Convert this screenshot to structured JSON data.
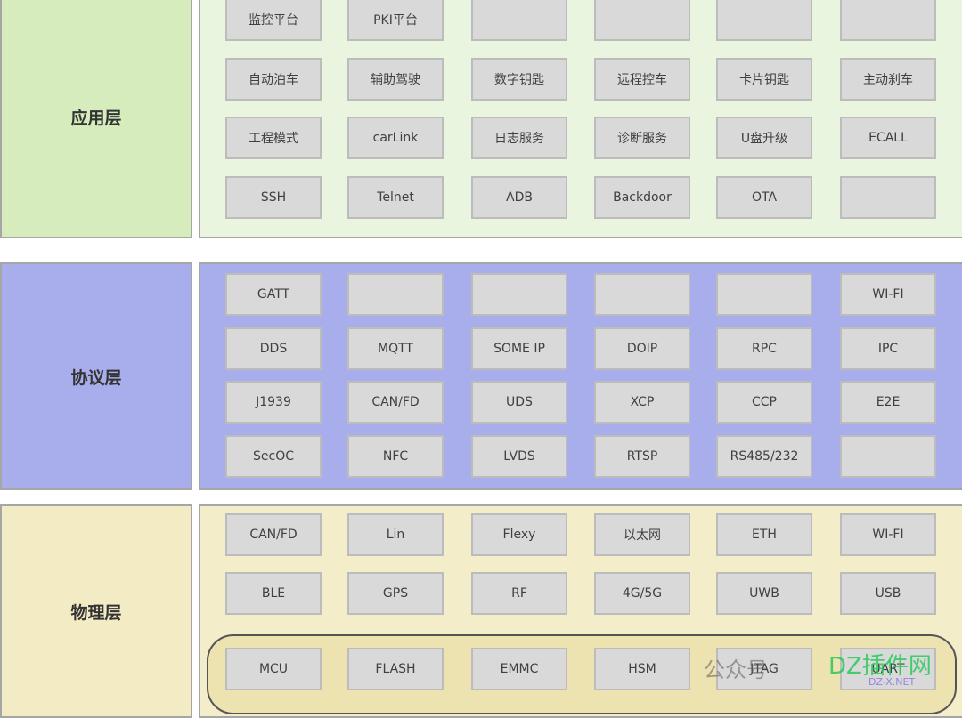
{
  "layers": [
    {
      "name": "应用层",
      "colors": {
        "label_bg": "#d6ecbd",
        "panel_bg": "#eaf5df"
      },
      "rows": [
        [
          "监控平台",
          "PKI平台",
          "",
          "",
          "",
          ""
        ],
        [
          "自动泊车",
          "辅助驾驶",
          "数字钥匙",
          "远程控车",
          "卡片钥匙",
          "主动刹车"
        ],
        [
          "工程模式",
          "carLink",
          "日志服务",
          "诊断服务",
          "U盘升级",
          "ECALL"
        ],
        [
          "SSH",
          "Telnet",
          "ADB",
          "Backdoor",
          "OTA",
          ""
        ]
      ]
    },
    {
      "name": "协议层",
      "colors": {
        "label_bg": "#a7aeeb",
        "panel_bg": "#a7aeeb"
      },
      "rows": [
        [
          "GATT",
          "",
          "",
          "",
          "",
          "WI-FI"
        ],
        [
          "DDS",
          "MQTT",
          "SOME IP",
          "DOIP",
          "RPC",
          "IPC"
        ],
        [
          "J1939",
          "CAN/FD",
          "UDS",
          "XCP",
          "CCP",
          "E2E"
        ],
        [
          "SecOC",
          "NFC",
          "LVDS",
          "RTSP",
          "RS485/232",
          ""
        ]
      ]
    },
    {
      "name": "物理层",
      "colors": {
        "label_bg": "#f2ebc4",
        "panel_bg": "#f3edc9"
      },
      "rows": [
        [
          "CAN/FD",
          "Lin",
          "Flexy",
          "以太网",
          "ETH",
          "WI-FI"
        ],
        [
          "BLE",
          "GPS",
          "RF",
          "4G/5G",
          "UWB",
          "USB"
        ],
        [
          "MCU",
          "FLASH",
          "EMMC",
          "HSM",
          "JTAG",
          "UART"
        ]
      ]
    }
  ],
  "watermark": {
    "text1": "公众号",
    "text2": "DZ插件网",
    "text3": "DZ-X.NET"
  }
}
